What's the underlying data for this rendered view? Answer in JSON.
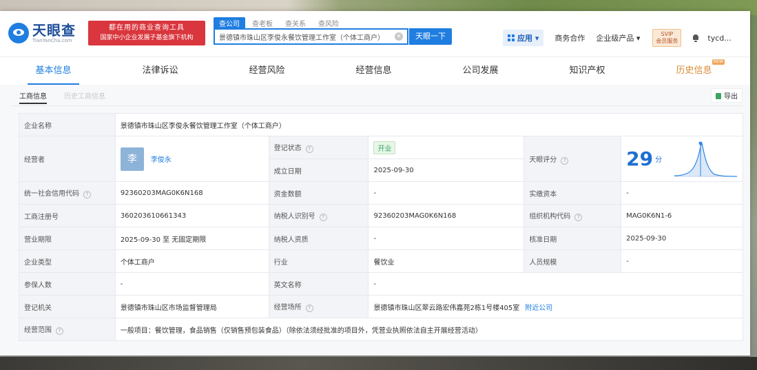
{
  "header": {
    "logo_cn": "天眼查",
    "logo_en": "TianYanCha.com",
    "promo_line1": "都在用的商业查询工具",
    "promo_line2": "国家中小企业发展子基金旗下机构",
    "search_tabs": [
      "查公司",
      "查老板",
      "查关系",
      "查风险"
    ],
    "search_value": "景德镇市珠山区李俊永餐饮管理工作室（个体工商户）",
    "search_button": "天眼一下",
    "nav": {
      "app": "应用",
      "business": "商务合作",
      "enterprise": "企业级产品",
      "svip_1": "SVIP",
      "svip_2": "会员服务",
      "user": "tycd..."
    }
  },
  "tabs": [
    "基本信息",
    "法律诉讼",
    "经营风险",
    "经营信息",
    "公司发展",
    "知识产权",
    "历史信息"
  ],
  "new_badge": "NEW",
  "subtabs": {
    "active": "工商信息",
    "inactive": "历史工商信息"
  },
  "export_label": "导出",
  "info": {
    "company_name_label": "企业名称",
    "company_name": "景德镇市珠山区李俊永餐饮管理工作室（个体工商户）",
    "operator_label": "经营者",
    "operator_avatar": "李",
    "operator_name": "李俊永",
    "reg_status_label": "登记状态",
    "reg_status": "开业",
    "score_label": "天眼评分",
    "score": "29",
    "score_unit": "分",
    "founded_label": "成立日期",
    "founded": "2025-09-30",
    "credit_code_label": "统一社会信用代码",
    "credit_code": "92360203MAG0K6N168",
    "capital_label": "资金数额",
    "capital": "-",
    "paid_capital_label": "实缴资本",
    "paid_capital": "-",
    "reg_no_label": "工商注册号",
    "reg_no": "360203610661343",
    "taxpayer_id_label": "纳税人识别号",
    "taxpayer_id": "92360203MAG0K6N168",
    "org_code_label": "组织机构代码",
    "org_code": "MAG0K6N1-6",
    "term_label": "营业期限",
    "term": "2025-09-30 至 无固定期限",
    "taxpayer_qual_label": "纳税人资质",
    "taxpayer_qual": "-",
    "approval_date_label": "核准日期",
    "approval_date": "2025-09-30",
    "type_label": "企业类型",
    "type": "个体工商户",
    "industry_label": "行业",
    "industry": "餐饮业",
    "staff_size_label": "人员规模",
    "staff_size": "-",
    "insured_label": "参保人数",
    "insured": "-",
    "english_name_label": "英文名称",
    "english_name": "-",
    "authority_label": "登记机关",
    "authority": "景德镇市珠山区市场监督管理局",
    "address_label": "经营场所",
    "address": "景德镇市珠山区翠云路宏伟嘉苑2栋1号楼405室",
    "nearby_link": "附近公司",
    "scope_label": "经营范围",
    "scope": "一般项目：餐饮管理，食品销售（仅销售预包装食品）（除依法须经批准的项目外，凭营业执照依法自主开展经营活动）"
  },
  "colors": {
    "primary": "#1f7ee0",
    "promo": "#d9363e",
    "history": "#d98a35",
    "status_green": "#3aa564"
  }
}
